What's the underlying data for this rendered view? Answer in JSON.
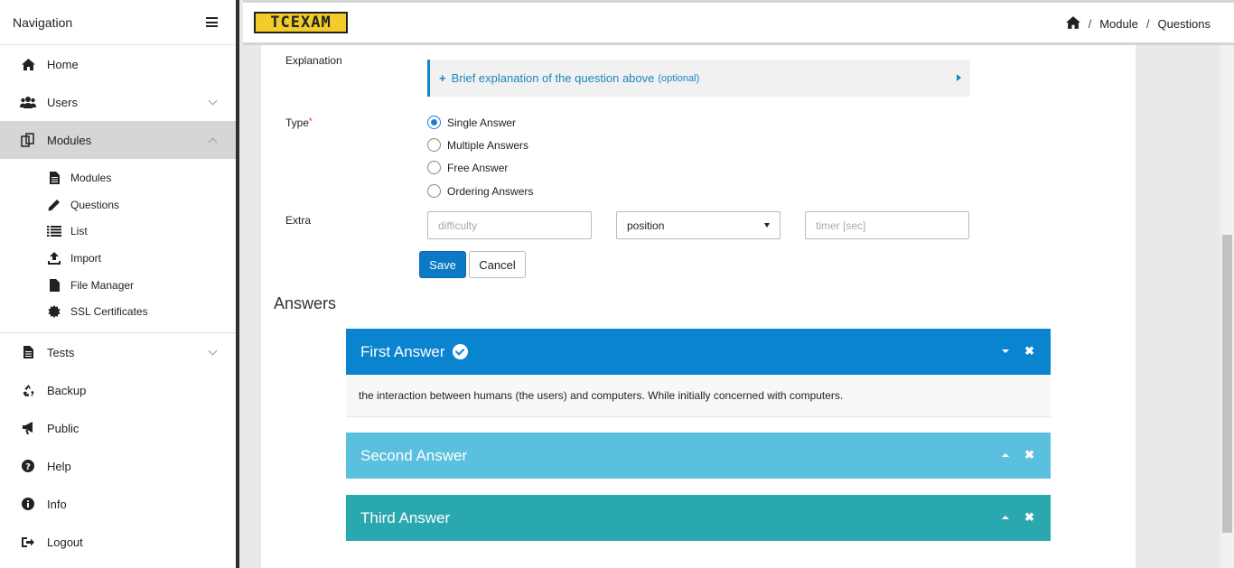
{
  "sidebar": {
    "title": "Navigation",
    "items": [
      {
        "label": "Home",
        "icon": "home-icon"
      },
      {
        "label": "Users",
        "icon": "users-icon"
      },
      {
        "label": "Modules",
        "icon": "modules-icon"
      },
      {
        "label": "Tests",
        "icon": "tests-icon"
      },
      {
        "label": "Backup",
        "icon": "recycle-icon"
      },
      {
        "label": "Public",
        "icon": "megaphone-icon"
      },
      {
        "label": "Help",
        "icon": "help-icon"
      },
      {
        "label": "Info",
        "icon": "info-icon"
      },
      {
        "label": "Logout",
        "icon": "logout-icon"
      }
    ],
    "submenu": [
      {
        "label": "Modules",
        "icon": "file-icon"
      },
      {
        "label": "Questions",
        "icon": "pencil-icon"
      },
      {
        "label": "List",
        "icon": "list-icon"
      },
      {
        "label": "Import",
        "icon": "upload-icon"
      },
      {
        "label": "File Manager",
        "icon": "file-icon"
      },
      {
        "label": "SSL Certificates",
        "icon": "certificate-icon"
      }
    ]
  },
  "header": {
    "logo": "TCEXAM",
    "breadcrumb": [
      "Module",
      "Questions"
    ]
  },
  "form": {
    "explanation_label": "Explanation",
    "explanation_toggle": "Brief explanation of the question above",
    "explanation_optional": "(optional)",
    "type_label": "Type",
    "type_required": "*",
    "type_options": [
      "Single Answer",
      "Multiple Answers",
      "Free Answer",
      "Ordering Answers"
    ],
    "type_selected": "Single Answer",
    "extra_label": "Extra",
    "difficulty_placeholder": "difficulty",
    "position_value": "position",
    "timer_placeholder": "timer [sec]",
    "save_label": "Save",
    "cancel_label": "Cancel"
  },
  "answers": {
    "title": "Answers",
    "items": [
      {
        "title": "First Answer",
        "color": "#0b84cf",
        "body": "the interaction between humans (the users) and computers. While initially concerned with computers.",
        "correct": true
      },
      {
        "title": "Second Answer",
        "color": "#5bbfde"
      },
      {
        "title": "Third Answer",
        "color": "#2aa8b0"
      }
    ]
  },
  "colors": {
    "accent": "#0b79c6",
    "active_nav": "#d6d6d6",
    "logo_bg": "#f2cc2a"
  }
}
